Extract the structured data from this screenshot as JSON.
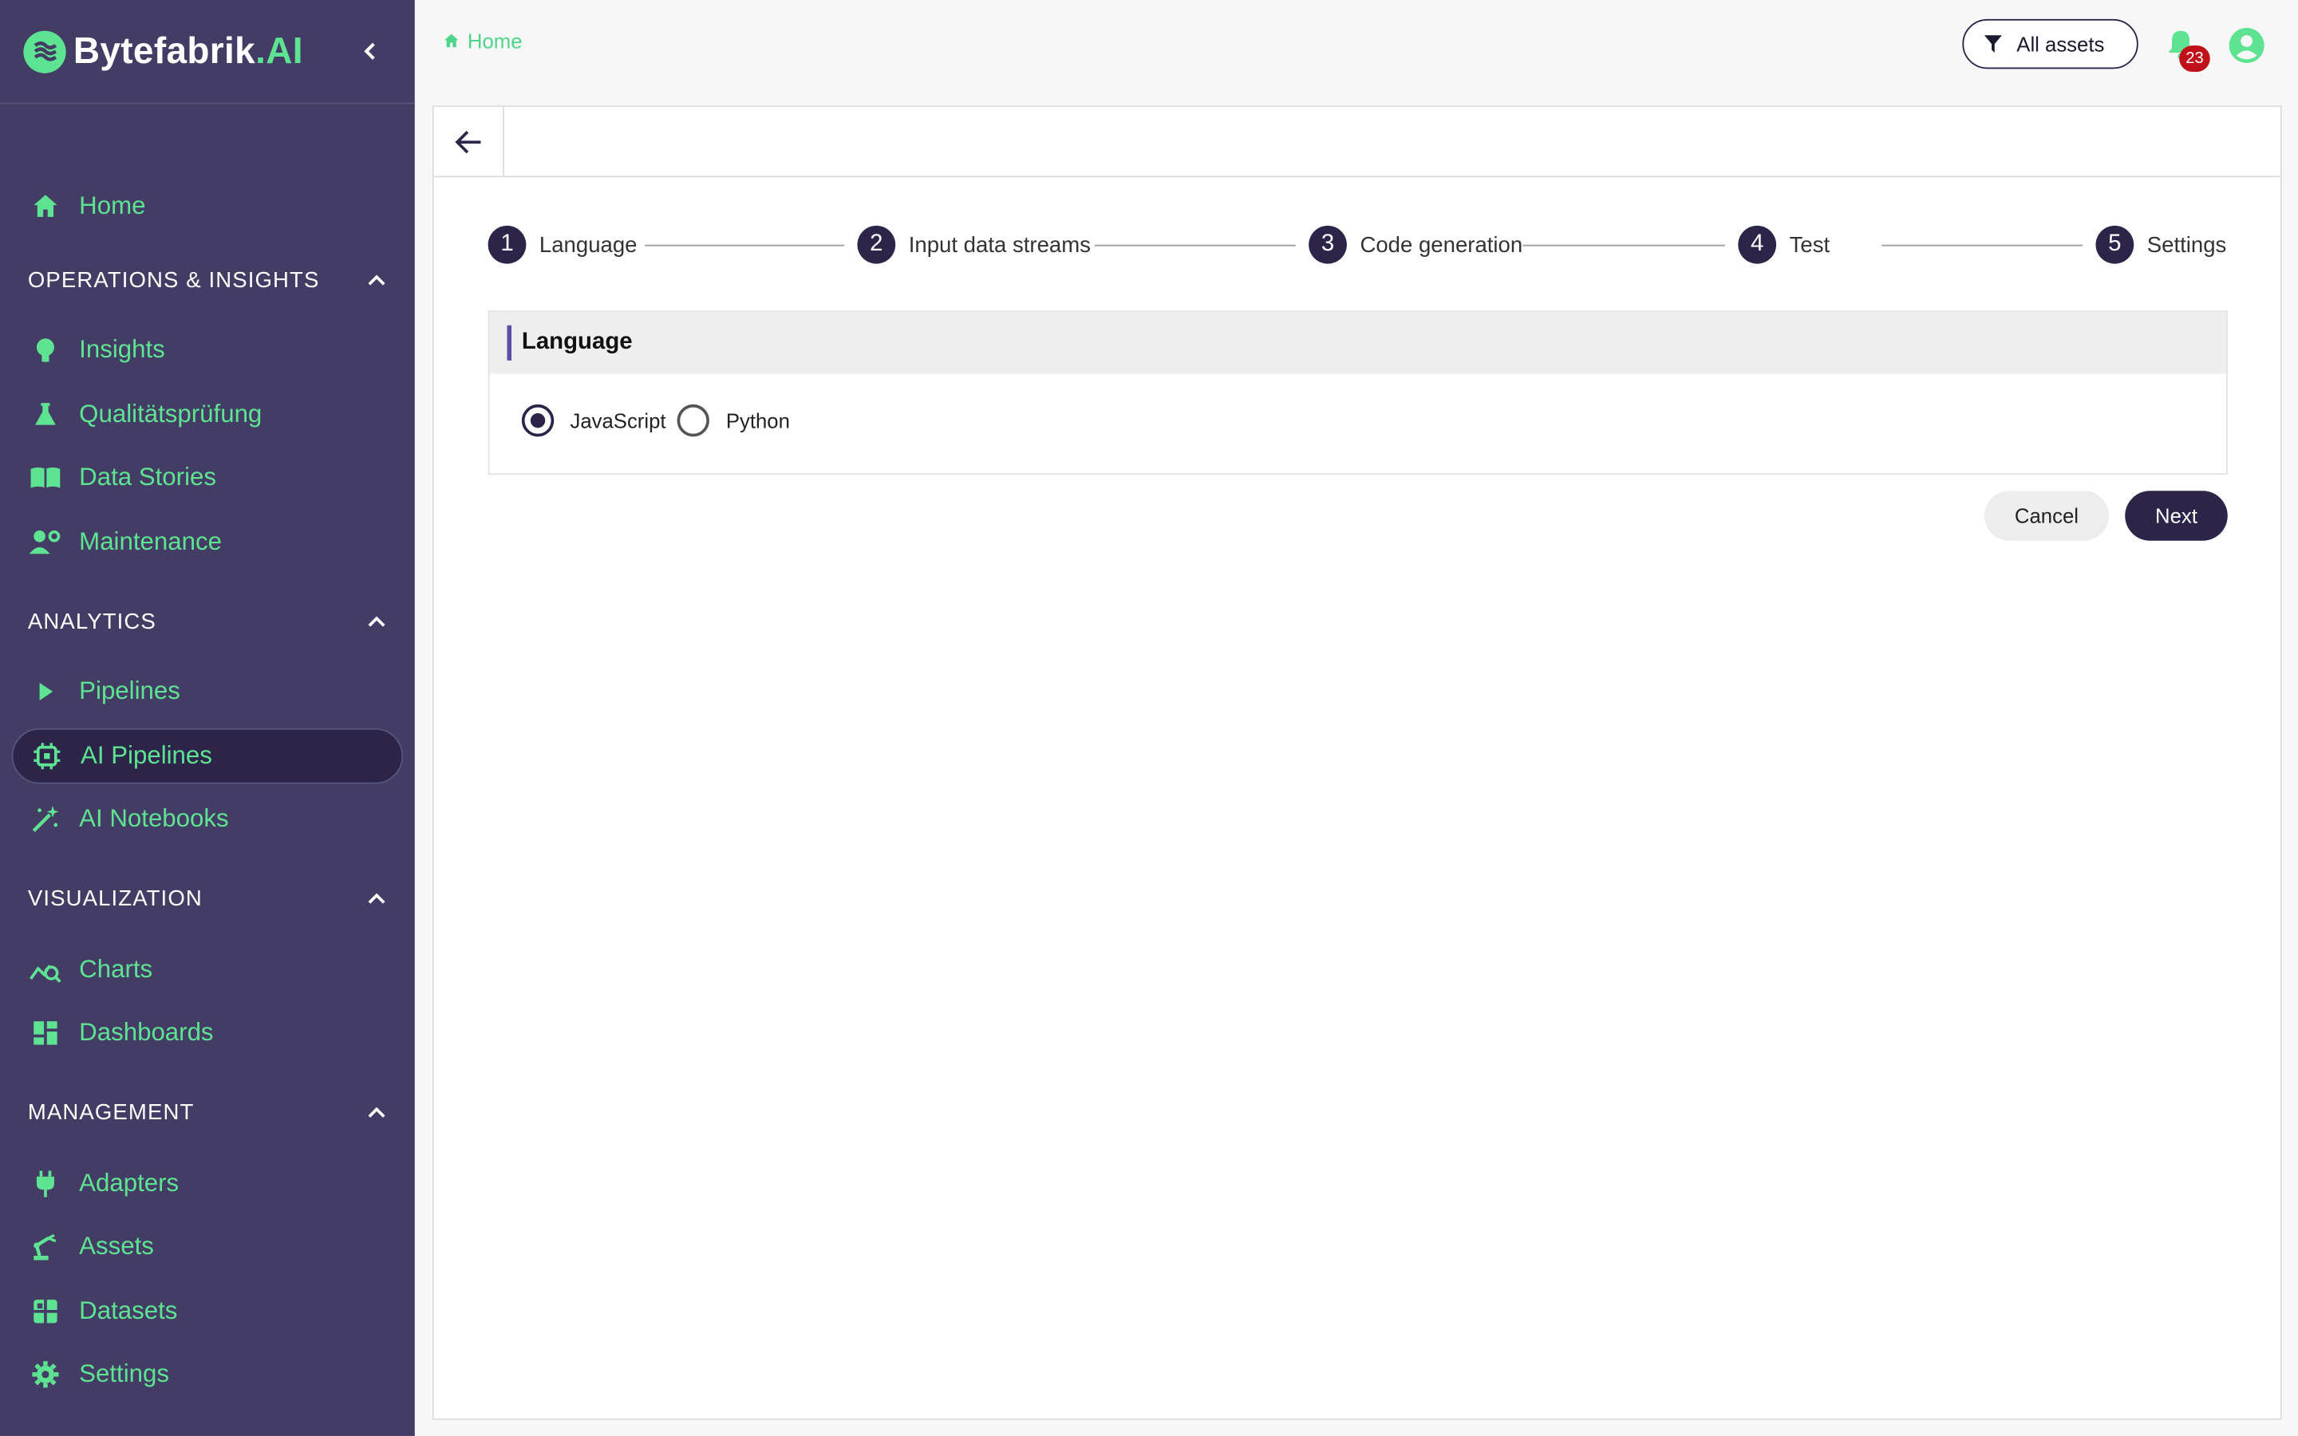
{
  "brand": {
    "name": "Bytefabrik",
    "suffix": ".AI"
  },
  "sidebar": {
    "home": "Home",
    "sections": [
      {
        "title": "OPERATIONS & INSIGHTS",
        "items": [
          "Insights",
          "Qualitätsprüfung",
          "Data Stories",
          "Maintenance"
        ]
      },
      {
        "title": "ANALYTICS",
        "items": [
          "Pipelines",
          "AI Pipelines",
          "AI Notebooks"
        ]
      },
      {
        "title": "VISUALIZATION",
        "items": [
          "Charts",
          "Dashboards"
        ]
      },
      {
        "title": "MANAGEMENT",
        "items": [
          "Adapters",
          "Assets",
          "Datasets",
          "Settings"
        ]
      }
    ],
    "active_item": "AI Pipelines"
  },
  "topbar": {
    "breadcrumb": "Home",
    "filter_label": "All assets",
    "notification_count": "23"
  },
  "stepper": {
    "steps": [
      {
        "num": "1",
        "label": "Language"
      },
      {
        "num": "2",
        "label": "Input data streams"
      },
      {
        "num": "3",
        "label": "Code generation"
      },
      {
        "num": "4",
        "label": "Test"
      },
      {
        "num": "5",
        "label": "Settings"
      }
    ],
    "current_step": 1
  },
  "language_panel": {
    "title": "Language",
    "options": [
      "JavaScript",
      "Python"
    ],
    "selected": "JavaScript"
  },
  "actions": {
    "cancel": "Cancel",
    "next": "Next"
  },
  "colors": {
    "sidebar_bg": "#433c64",
    "accent": "#5ee392",
    "primary": "#2c2549",
    "badge": "#c0101a"
  }
}
